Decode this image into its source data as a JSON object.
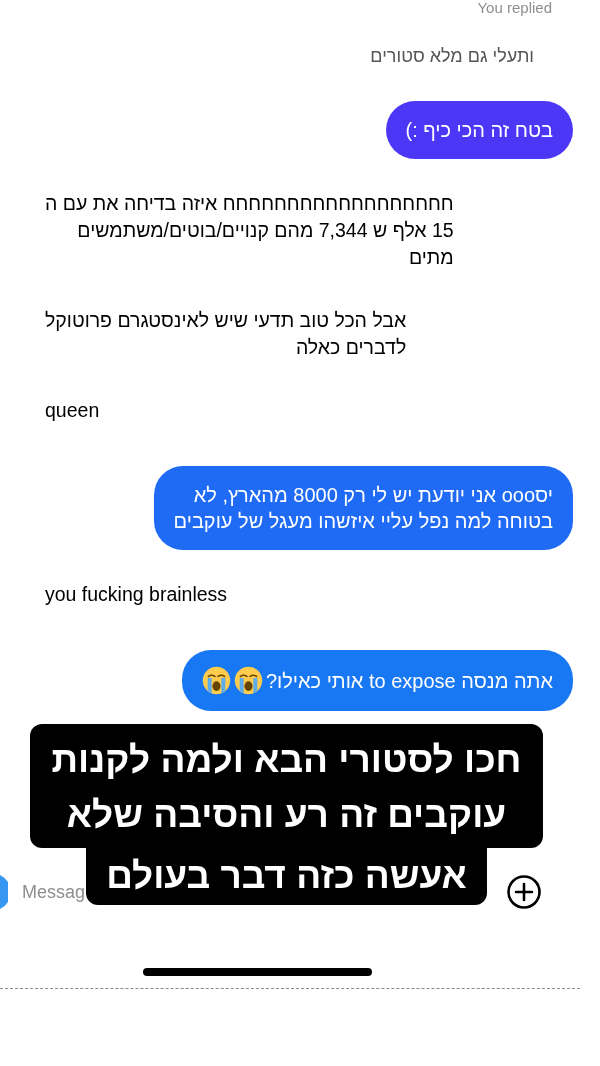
{
  "reply_header": {
    "label": "You replied"
  },
  "replied_to": {
    "text": "ותעלי גם מלא סטורים"
  },
  "messages": [
    {
      "kind": "sent",
      "text": "בטח זה הכי כיף :)",
      "color": "#4b37f5"
    },
    {
      "kind": "received",
      "text": "חחחחחחחחחחחחחחחחחח איזה בדיחה את עם ה\n15 אלף ש 7,344 מהם קנויים/בוטים/משתמשים\nמתים"
    },
    {
      "kind": "received",
      "text": "אבל הכל טוב תדעי שיש לאינסטגרם פרוטוקל\nלדברים כאלה"
    },
    {
      "kind": "received",
      "text": "queen"
    },
    {
      "kind": "sent",
      "text": "יסooo אני יודעת יש לי רק 8000 מהארץ, לא\nבטוחה למה נפל עליי איזשהו מעגל של עוקבים",
      "color": "#1f6bf6"
    },
    {
      "kind": "received",
      "text": "you fucking brainless"
    },
    {
      "kind": "sent",
      "text": "אתה מנסה to expose אותי כאילו?",
      "color": "#1877f2",
      "emojis": [
        {
          "kind": "crying"
        },
        {
          "kind": "crying"
        }
      ]
    }
  ],
  "caption": [
    {
      "text": "חכו לסטורי הבא ולמה לקנות\nעוקבים זה רע והסיבה שלא"
    },
    {
      "text": "אעשה כזה דבר בעולם"
    }
  ],
  "composer": {
    "placeholder": "Messag"
  }
}
